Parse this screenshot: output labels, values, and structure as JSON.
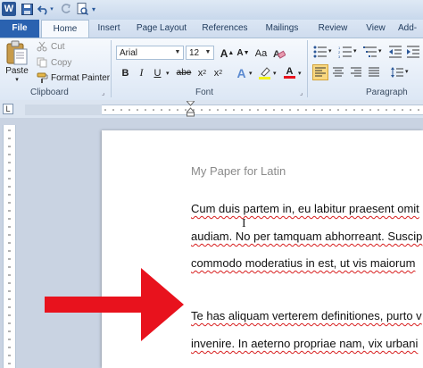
{
  "qat": {
    "app_icon": "W",
    "icons": [
      "save-icon",
      "undo-icon",
      "redo-icon",
      "print-preview-icon",
      "customize-qat-icon"
    ]
  },
  "tabs": [
    {
      "label": "File"
    },
    {
      "label": "Home"
    },
    {
      "label": "Insert"
    },
    {
      "label": "Page Layout"
    },
    {
      "label": "References"
    },
    {
      "label": "Mailings"
    },
    {
      "label": "Review"
    },
    {
      "label": "View"
    },
    {
      "label": "Add-"
    }
  ],
  "clipboard": {
    "paste_label": "Paste",
    "cut_label": "Cut",
    "copy_label": "Copy",
    "format_painter_label": "Format Painter",
    "group_label": "Clipboard"
  },
  "font": {
    "font_name": "Arial",
    "font_size": "12",
    "bold": "B",
    "italic": "I",
    "underline": "U",
    "strikethrough": "abe",
    "subscript": "x",
    "superscript": "x",
    "grow": "A",
    "shrink": "A",
    "change_case": "Aa",
    "text_effects": "A",
    "font_color": "A",
    "group_label": "Font"
  },
  "paragraph": {
    "group_label": "Paragraph"
  },
  "document": {
    "title": "My Paper for Latin",
    "lines": [
      "Cum duis partem in, eu labitur praesent omit",
      "audiam. No per tamquam abhorreant. Suscip",
      "commodo moderatius in est, ut vis maiorum",
      "Te has aliquam verterem definitiones, purto v",
      "invenire. In aeterno propriae nam, vix urbani"
    ]
  },
  "colors": {
    "file_tab": "#2a62b0",
    "arrow": "#e8121d",
    "spell_underline": "#d82020"
  }
}
